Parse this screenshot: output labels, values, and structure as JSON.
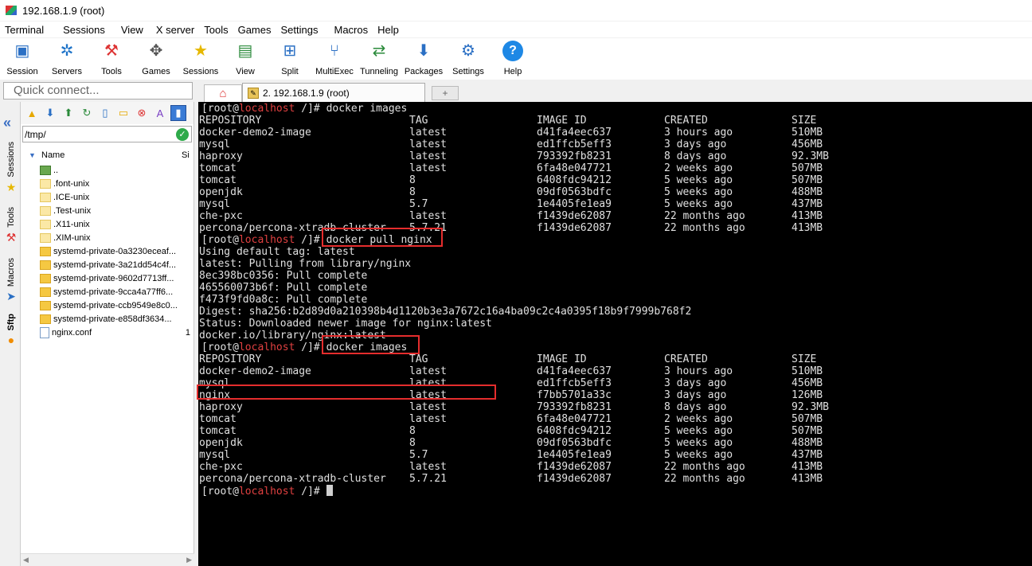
{
  "window": {
    "title": "192.168.1.9 (root)"
  },
  "menu": [
    "Terminal",
    "Sessions",
    "View",
    "X server",
    "Tools",
    "Games",
    "Settings",
    "Macros",
    "Help"
  ],
  "toolbar": [
    {
      "label": "Session",
      "icon": "session-icon"
    },
    {
      "label": "Servers",
      "icon": "servers-icon"
    },
    {
      "label": "Tools",
      "icon": "tools-icon"
    },
    {
      "label": "Games",
      "icon": "games-icon"
    },
    {
      "label": "Sessions",
      "icon": "sessions-star-icon"
    },
    {
      "label": "View",
      "icon": "view-icon"
    },
    {
      "label": "Split",
      "icon": "split-icon"
    },
    {
      "label": "MultiExec",
      "icon": "multiexec-icon"
    },
    {
      "label": "Tunneling",
      "icon": "tunneling-icon"
    },
    {
      "label": "Packages",
      "icon": "packages-icon"
    },
    {
      "label": "Settings",
      "icon": "settings-icon"
    },
    {
      "label": "Help",
      "icon": "help-icon"
    }
  ],
  "quick_connect": {
    "placeholder": "Quick connect..."
  },
  "tabs": {
    "active_label": "2. 192.168.1.9 (root)"
  },
  "side_tabs": [
    "Sessions",
    "Tools",
    "Macros",
    "Sftp"
  ],
  "sftp": {
    "path": "/tmp/",
    "columns": {
      "name": "Name",
      "size": "Si"
    },
    "files": [
      {
        "name": "..",
        "type": "up",
        "size": ""
      },
      {
        "name": ".font-unix",
        "type": "folder-light",
        "size": ""
      },
      {
        "name": ".ICE-unix",
        "type": "folder-light",
        "size": ""
      },
      {
        "name": ".Test-unix",
        "type": "folder-light",
        "size": ""
      },
      {
        "name": ".X11-unix",
        "type": "folder-light",
        "size": ""
      },
      {
        "name": ".XIM-unix",
        "type": "folder-light",
        "size": ""
      },
      {
        "name": "systemd-private-0a3230eceaf...",
        "type": "folder",
        "size": ""
      },
      {
        "name": "systemd-private-3a21dd54c4f...",
        "type": "folder",
        "size": ""
      },
      {
        "name": "systemd-private-9602d7713ff...",
        "type": "folder",
        "size": ""
      },
      {
        "name": "systemd-private-9cca4a77ff6...",
        "type": "folder",
        "size": ""
      },
      {
        "name": "systemd-private-ccb9549e8c0...",
        "type": "folder",
        "size": ""
      },
      {
        "name": "systemd-private-e858df3634...",
        "type": "folder",
        "size": ""
      },
      {
        "name": "nginx.conf",
        "type": "file",
        "size": "1"
      }
    ]
  },
  "terminal": {
    "prompt": {
      "open": "[root@",
      "host": "localhost",
      "close": " /]# "
    },
    "headers": [
      "REPOSITORY",
      "TAG",
      "IMAGE ID",
      "CREATED",
      "SIZE"
    ],
    "cmd1": "docker images",
    "table1": [
      [
        "docker-demo2-image",
        "latest",
        "d41fa4eec637",
        "3 hours ago",
        "510MB"
      ],
      [
        "mysql",
        "latest",
        "ed1ffcb5eff3",
        "3 days ago",
        "456MB"
      ],
      [
        "haproxy",
        "latest",
        "793392fb8231",
        "8 days ago",
        "92.3MB"
      ],
      [
        "tomcat",
        "latest",
        "6fa48e047721",
        "2 weeks ago",
        "507MB"
      ],
      [
        "tomcat",
        "8",
        "6408fdc94212",
        "5 weeks ago",
        "507MB"
      ],
      [
        "openjdk",
        "8",
        "09df0563bdfc",
        "5 weeks ago",
        "488MB"
      ],
      [
        "mysql",
        "5.7",
        "1e4405fe1ea9",
        "5 weeks ago",
        "437MB"
      ],
      [
        "che-pxc",
        "latest",
        "f1439de62087",
        "22 months ago",
        "413MB"
      ],
      [
        "percona/percona-xtradb-cluster",
        "5.7.21",
        "f1439de62087",
        "22 months ago",
        "413MB"
      ]
    ],
    "cmd2": "docker pull nginx",
    "pull_output": [
      "Using default tag: latest",
      "latest: Pulling from library/nginx",
      "8ec398bc0356: Pull complete",
      "465560073b6f: Pull complete",
      "f473f9fd0a8c: Pull complete",
      "Digest: sha256:b2d89d0a210398b4d1120b3e3a7672c16a4ba09c2c4a0395f18b9f7999b768f2",
      "Status: Downloaded newer image for nginx:latest",
      "docker.io/library/nginx:latest"
    ],
    "cmd3": "docker images",
    "table2": [
      [
        "docker-demo2-image",
        "latest",
        "d41fa4eec637",
        "3 hours ago",
        "510MB"
      ],
      [
        "mysql",
        "latest",
        "ed1ffcb5eff3",
        "3 days ago",
        "456MB"
      ],
      [
        "nginx",
        "latest",
        "f7bb5701a33c",
        "3 days ago",
        "126MB"
      ],
      [
        "haproxy",
        "latest",
        "793392fb8231",
        "8 days ago",
        "92.3MB"
      ],
      [
        "tomcat",
        "latest",
        "6fa48e047721",
        "2 weeks ago",
        "507MB"
      ],
      [
        "tomcat",
        "8",
        "6408fdc94212",
        "5 weeks ago",
        "507MB"
      ],
      [
        "openjdk",
        "8",
        "09df0563bdfc",
        "5 weeks ago",
        "488MB"
      ],
      [
        "mysql",
        "5.7",
        "1e4405fe1ea9",
        "5 weeks ago",
        "437MB"
      ],
      [
        "che-pxc",
        "latest",
        "f1439de62087",
        "22 months ago",
        "413MB"
      ],
      [
        "percona/percona-xtradb-cluster",
        "5.7.21",
        "f1439de62087",
        "22 months ago",
        "413MB"
      ]
    ]
  },
  "colors": {
    "terminal_bg": "#000000",
    "terminal_fg": "#e0e0e0",
    "host": "#e04040",
    "highlight": "#e52d2d"
  }
}
